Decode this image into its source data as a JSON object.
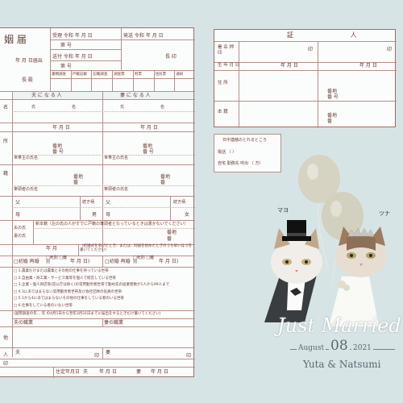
{
  "left_form": {
    "title": "姻 届",
    "date_line": "年 月 日届出",
    "to_line": "長 殿",
    "received": "受理 令和 年 月 日",
    "received_no": "第 号",
    "sent": "送付 令和 年 月 日",
    "sent_no": "第 号",
    "issued": "発送 令和 年 月 日",
    "chief": "長 印",
    "check_cells": [
      "書類調査",
      "戸籍記載",
      "記載調査",
      "調査票",
      "附票",
      "住民票",
      "通知"
    ],
    "husband_header": "夫 に な る 人",
    "wife_header": "妻 に な る 人",
    "name_row": "名",
    "furigana": [
      "氏",
      "名",
      "氏",
      "名"
    ],
    "birth_row": "年 月 日",
    "address_row": "所",
    "address_sub": [
      "番地",
      "番 号",
      "番地",
      "番 号"
    ],
    "householder": [
      "世帯主の氏名",
      "世帯主の氏名"
    ],
    "domicile_row": "籍",
    "domicile_sub": [
      "番地",
      "番",
      "番地",
      "番"
    ],
    "head_label": [
      "筆頭者の氏名",
      "筆頭者の氏名"
    ],
    "parents": [
      "父",
      "続き柄",
      "続き柄",
      "父"
    ],
    "mother": [
      "母",
      "男",
      "母",
      "女"
    ],
    "after_marriage": "新本籍（左の氏の人がすでに戸籍の筆頭者となっているときは書かないでください）",
    "surname_choice": [
      "夫の氏",
      "妻の氏"
    ],
    "new_domicile": [
      "番地",
      "番"
    ],
    "cohabit_start": "年 月",
    "cohabit_note": "（結婚式をあげたとき、または、同居を始めたときのうち早いほうを書いてください）",
    "first_marriage": [
      "□初婚 再婚",
      "□死別 □離別",
      "年 月 日)",
      "□初婚 再婚",
      "□死別 □離別",
      "年 月 日)"
    ],
    "occupation_items": [
      "□ 1.農業だけまたは農業とその他の仕事を持っている世帯",
      "□ 2.自由業・商工業・サービス業等を個人で経営している世帯",
      "□ 3.企業・個人商店等(官公庁は除く)の常用勤労者世帯で勤め先の従業者数が1人から99人まで",
      "□ 4.3にあてはまらない常用勤労者世帯及び会社団体の役員の世帯",
      "□ 5.1から4にあてはまらないその他の仕事をしている者のいる世帯",
      "□ 6.仕事をしている者のいない世帯"
    ],
    "census_note": "(国勢調査の年… 年 の4月1日から翌年3月31日までに届出をするときだけ書いてください)",
    "husband_job": "夫の職業",
    "wife_job": "妻の職業",
    "other_row": "他",
    "signer_row": "人",
    "signer_sub": [
      "夫",
      "印",
      "妻",
      "印"
    ],
    "mark_row": "印",
    "date_footer": [
      "住定年月日",
      "夫",
      "年 月 日",
      "妻",
      "年 月 日"
    ]
  },
  "right_form": {
    "title": "証 人",
    "sign_row": "署 名 押 印",
    "seal": "印",
    "birth_row": "生 年 月 日",
    "birth_val": [
      "年 月 日",
      "年 月 日"
    ],
    "address_row": "住 所",
    "address_sub": [
      "番地",
      "番 号",
      "番地",
      "番 号"
    ],
    "domicile_row": "本 籍",
    "domicile_sub": [
      "番地",
      "番",
      "番地",
      "番"
    ]
  },
  "contact_box": {
    "title": "日中連絡のとれるところ",
    "line1": "電話 （ ）",
    "line2": "自宅 勤務先 呼出 （ 方）"
  },
  "couple": {
    "groom_tag": "マヨ",
    "bride_tag": "ツナ",
    "script": "Just Married",
    "month": "August",
    "day": "08",
    "year": "2021",
    "names": "Yuta & Natsumi"
  },
  "colors": {
    "background": "#d7e4e6",
    "form_line": "#b69089",
    "text": "#5a3a32",
    "balloon": "#d6d3c3"
  }
}
